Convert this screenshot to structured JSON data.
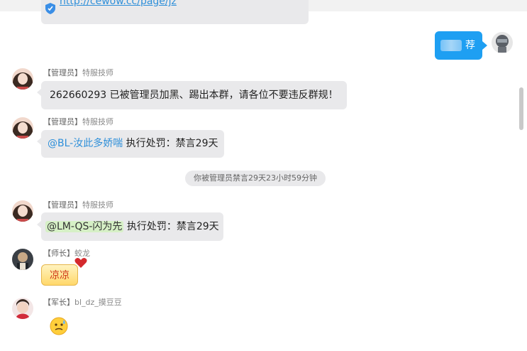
{
  "top_link": {
    "text": "http://cewow.cc/page/jz"
  },
  "self_message": {
    "text": "荐"
  },
  "messages": [
    {
      "role": "【管理员】",
      "name": "特服技师",
      "text": "262660293 已被管理员加黑、踢出本群，请各位不要违反群规！"
    },
    {
      "role": "【管理员】",
      "name": "特服技师",
      "mention": "@BL-汝此多娇喘",
      "text": " 执行处罚：禁言29天"
    },
    {
      "role": "【管理员】",
      "name": "特服技师",
      "mention": "@LM-QS-闪为先",
      "text": " 执行处罚：禁言29天"
    },
    {
      "role": "【师长】",
      "name": "蛟龙",
      "text": "凉凉"
    },
    {
      "role": "【军长】",
      "name": "bl_dz_摸豆豆"
    }
  ],
  "system_notice": "你被管理员禁言29天23小时59分钟",
  "colors": {
    "self_bubble": "#1e9ff2",
    "bubble": "#e9e9eb",
    "mention": "#2e8fd9"
  },
  "icons": {
    "link": "shield-icon",
    "emoji": "sweat-emoji-icon"
  }
}
